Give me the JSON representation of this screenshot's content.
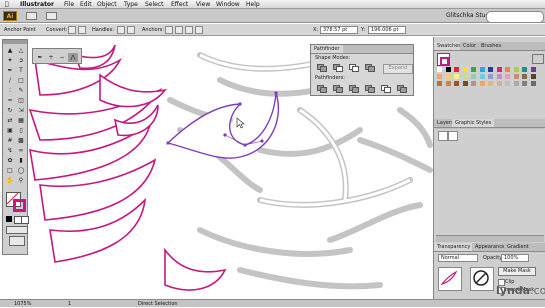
{
  "menubar": {
    "apple": "",
    "app_name": "Illustrator",
    "items": [
      "File",
      "Edit",
      "Object",
      "Type",
      "Select",
      "Effect",
      "View",
      "Window",
      "Help"
    ]
  },
  "appbar": {
    "logo": "Ai",
    "workspace": "Glitschka Studios"
  },
  "controlbar": {
    "tool_label": "Anchor Point",
    "convert_label": "Convert:",
    "handles_label": "Handles:",
    "anchors_label": "Anchors:",
    "x_label": "X:",
    "x_value": "378.57 pt",
    "y_label": "Y:",
    "y_value": "196.006 pt"
  },
  "pathfinder": {
    "tab": "Pathfinder",
    "shape_modes_label": "Shape Modes:",
    "pathfinders_label": "Pathfinders:",
    "expand_label": "Expand"
  },
  "dock": {
    "tabs_top": [
      "Swatches",
      "Color",
      "Brushes"
    ],
    "tabs_mid": [
      "Layers",
      "Graphic Styles"
    ],
    "tabs_bottom": [
      "Transparency",
      "Appearance",
      "Gradient"
    ],
    "blend_mode": "Normal",
    "opacity_label": "Opacity:",
    "opacity_value": "100%",
    "make_mask_label": "Make Mask",
    "clip_label": "Clip",
    "invert_mask_label": "Invert Mask",
    "swatch_colors": [
      "#ffffff",
      "#000000",
      "#e8242c",
      "#f6e613",
      "#2bae4a",
      "#2aa8e0",
      "#2b3a94",
      "#e2227b",
      "#f08a24",
      "#a8cf45",
      "#1f8f8a",
      "#6d3b91",
      "#f2a37a",
      "#f9ce7f",
      "#f6f08b",
      "#c7e086",
      "#8bd1b2",
      "#78c6e8",
      "#8e9ed0",
      "#b993c7",
      "#e99bc0",
      "#c98e6b",
      "#8b6a4b",
      "#5a3f2a",
      "#d2691e",
      "#cd853f",
      "#a0522d",
      "#8b4513",
      "#bc8f8f",
      "#f4a460",
      "#deb887",
      "#d2b48c",
      "#c0c0c0",
      "#a9a9a9",
      "#808080",
      "#696969"
    ]
  },
  "statusbar": {
    "zoom": "1075%",
    "artboard": "1",
    "tool_name": "Direct Selection"
  },
  "watermark": {
    "brand": "lynda",
    "suffix": ".com"
  }
}
